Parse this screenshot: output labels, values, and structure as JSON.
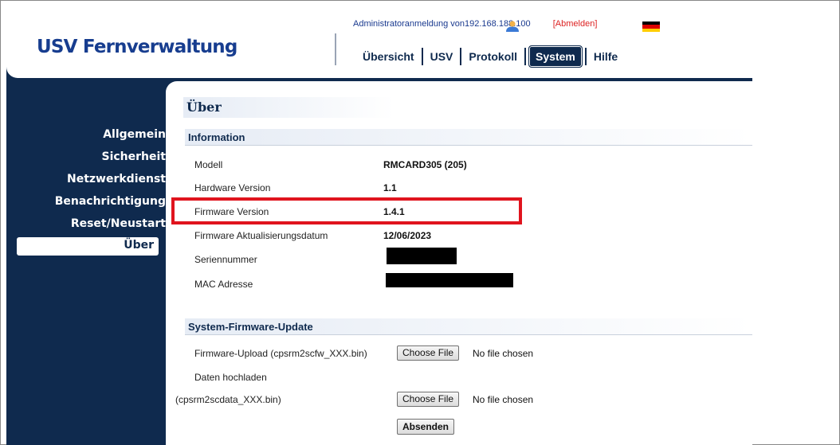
{
  "app": {
    "logo": "USV Fernverwaltung"
  },
  "header": {
    "admin_text": "Administratoranmeldung von192.168.188.100",
    "logout": "[Abmelden]",
    "flag_colors": [
      "#000000",
      "#dd0000",
      "#ffce00"
    ]
  },
  "nav": {
    "items": [
      {
        "label": "Übersicht",
        "active": false
      },
      {
        "label": "USV",
        "active": false
      },
      {
        "label": "Protokoll",
        "active": false
      },
      {
        "label": "System",
        "active": true
      },
      {
        "label": "Hilfe",
        "active": false
      }
    ]
  },
  "sidebar": {
    "items": [
      {
        "label": "Allgemein"
      },
      {
        "label": "Sicherheit"
      },
      {
        "label": "Netzwerkdienst"
      },
      {
        "label": "Benachrichtigung"
      },
      {
        "label": "Reset/Neustart"
      },
      {
        "label": "Über",
        "active": true
      }
    ]
  },
  "page": {
    "title": "Über",
    "information": {
      "heading": "Information",
      "rows": [
        {
          "label": "Modell",
          "value": "RMCARD305 (205)"
        },
        {
          "label": "Hardware Version",
          "value": "1.1"
        },
        {
          "label": "Firmware Version",
          "value": "1.4.1",
          "highlighted": true
        },
        {
          "label": "Firmware Aktualisierungsdatum",
          "value": "12/06/2023"
        },
        {
          "label": "Seriennummer",
          "value": "",
          "redacted": true
        },
        {
          "label": "MAC Adresse",
          "value": "",
          "redacted": true
        }
      ]
    },
    "firmware_update": {
      "heading": "System-Firmware-Update",
      "firmware_upload_label": "Firmware-Upload (cpsrm2scfw_XXX.bin)",
      "data_upload_label": "Daten hochladen",
      "data_upload_file_label": "(cpsrm2scdata_XXX.bin)",
      "choose_file_label": "Choose File",
      "no_file_text": "No file chosen",
      "submit_label": "Absenden"
    }
  },
  "colors": {
    "brand_dark": "#0f2a4e",
    "logo_blue": "#173d8f",
    "highlight_red": "#e0141e"
  }
}
